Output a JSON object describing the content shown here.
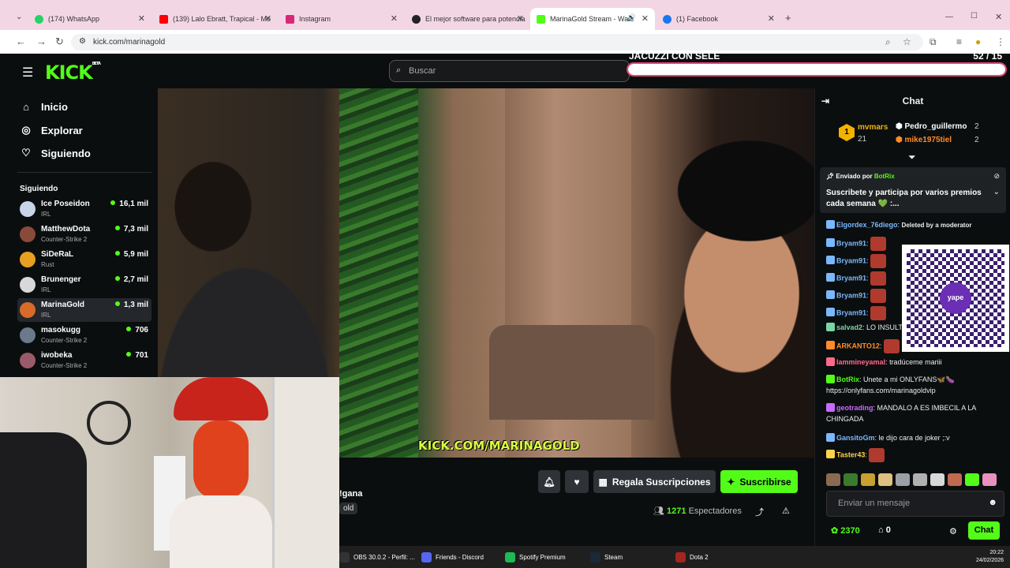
{
  "browser": {
    "tabs": [
      {
        "title": "(174) WhatsApp",
        "fav_color": "#25d366"
      },
      {
        "title": "(139) Lalo Ebratt, Trapical - Mo",
        "fav_color": "#ff0000"
      },
      {
        "title": "Instagram",
        "fav_color": "#d62976"
      },
      {
        "title": "El mejor software para potencia",
        "fav_color": "#222222"
      },
      {
        "title": "MarinaGold Stream - Watc",
        "fav_color": "#53fc18"
      },
      {
        "title": "(1) Facebook",
        "fav_color": "#1877f2"
      }
    ],
    "new_tab": "+",
    "url": "kick.com/marinagold"
  },
  "kick": {
    "logo": "KICK",
    "logo_beta": "BETA",
    "search_placeholder": "Buscar",
    "goal": {
      "title": "JACUZZI CON SELE",
      "count": "52 / 15",
      "progress_pct": 100
    },
    "accent": "#53fc18"
  },
  "sidebar": {
    "links": [
      {
        "label": "Inicio",
        "icon": "home-icon",
        "glyph": "⌂"
      },
      {
        "label": "Explorar",
        "icon": "compass-icon",
        "glyph": "◎"
      },
      {
        "label": "Siguiendo",
        "icon": "heart-icon",
        "glyph": "♡"
      }
    ],
    "following_header": "Siguiendo",
    "following": [
      {
        "name": "Ice Poseidon",
        "category": "IRL",
        "viewers": "16,1 mil",
        "avatar": "#c8d4e8"
      },
      {
        "name": "MatthewDota",
        "category": "Counter-Strike 2",
        "viewers": "7,3 mil",
        "avatar": "#8a4a3a"
      },
      {
        "name": "SiDeRaL",
        "category": "Rust",
        "viewers": "5,9 mil",
        "avatar": "#e8a020"
      },
      {
        "name": "Brunenger",
        "category": "IRL",
        "viewers": "2,7 mil",
        "avatar": "#d8d8d8"
      },
      {
        "name": "MarinaGold",
        "category": "IRL",
        "viewers": "1,3 mil",
        "avatar": "#d86a2a"
      },
      {
        "name": "masokugg",
        "category": "Counter-Strike 2",
        "viewers": "706",
        "avatar": "#6a7a8a"
      },
      {
        "name": "iwobeka",
        "category": "Counter-Strike 2",
        "viewers": "701",
        "avatar": "#9a5a6a"
      }
    ]
  },
  "video": {
    "watermark": "KICK.COM/MARINAGOLD"
  },
  "stream": {
    "title_fragment": "!gana",
    "category_fragment": "old",
    "gift_subs_label": "Regala Suscripciones",
    "subscribe_label": "Suscribirse",
    "viewers_count": "1271",
    "viewers_label": "Espectadores"
  },
  "chat": {
    "header": "Chat",
    "leaderboard": [
      {
        "rank": "1",
        "name": "mvmars",
        "count": "21",
        "color": "#f3b200"
      },
      {
        "name": "Pedro_guillermo",
        "count": "2",
        "color": "#ffffff"
      },
      {
        "name": "mike1975tiel",
        "count": "2",
        "color": "#ff8c2a"
      }
    ],
    "pinned": {
      "by_label": "Enviado por",
      "by_user": "BotRix",
      "message": "Suscribete y participa por varios premios cada semana 💚 :..."
    },
    "messages": [
      {
        "user": "Elgordex_76diego",
        "color": "#7ab8ff",
        "text": "Deleted by a moderator"
      },
      {
        "user": "Bryam91",
        "color": "#7ab8ff",
        "text": ""
      },
      {
        "user": "Bryam91",
        "color": "#7ab8ff",
        "text": ""
      },
      {
        "user": "Bryam91",
        "color": "#7ab8ff",
        "text": ""
      },
      {
        "user": "Bryam91",
        "color": "#7ab8ff",
        "text": ""
      },
      {
        "user": "Bryam91",
        "color": "#7ab8ff",
        "text": ""
      },
      {
        "user": "salvad2",
        "color": "#7ad4a4",
        "text": "LO INSULTA"
      },
      {
        "user": "ARKANTO12",
        "color": "#ff8c2a",
        "text": ""
      },
      {
        "user": "lammineyamal",
        "color": "#ff6a8a",
        "text": "tradúceme mariii"
      },
      {
        "user": "BotRix",
        "color": "#53fc18",
        "text": "Unete a mi ONLYFANS🦋🍆 https://onlyfans.com/marinagoldvip"
      },
      {
        "user": "geotrading",
        "color": "#c86aff",
        "text": "MANDALO A ES IMBECIL A LA CHINGADA"
      },
      {
        "user": "GansitoGm",
        "color": "#7ab8ff",
        "text": "le dijo cara de joker ;:v"
      },
      {
        "user": "Taster43",
        "color": "#ffd44a",
        "text": ""
      }
    ],
    "qr_label": "yape",
    "input_placeholder": "Enviar un mensaje",
    "points": "2370",
    "gifts": "0",
    "send_label": "Chat"
  },
  "taskbar": {
    "items": [
      {
        "label": "OBS 30.0.2 - Perfil: ...",
        "color": "#333333"
      },
      {
        "label": "Friends - Discord",
        "color": "#5865f2"
      },
      {
        "label": "Spotify Premium",
        "color": "#1db954"
      },
      {
        "label": "Steam",
        "color": "#1b2838"
      },
      {
        "label": "Dota 2",
        "color": "#a3261e"
      }
    ],
    "time": "20:22",
    "date": "24/02/2026"
  }
}
